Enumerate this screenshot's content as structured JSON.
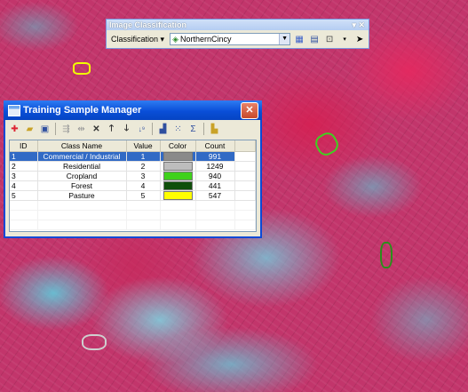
{
  "toolbar": {
    "title": "Image Classification",
    "menu_label": "Classification",
    "layer_value": "NorthernCincy"
  },
  "dialog": {
    "title": "Training Sample Manager",
    "columns": [
      "ID",
      "Class Name",
      "Value",
      "Color",
      "Count"
    ],
    "rows": [
      {
        "id": "1",
        "name": "Commercial / Industrial",
        "value": "1",
        "color": "#8a8a8a",
        "count": "991"
      },
      {
        "id": "2",
        "name": "Residential",
        "value": "2",
        "color": "#bdbdbd",
        "count": "1249"
      },
      {
        "id": "3",
        "name": "Cropland",
        "value": "3",
        "color": "#3fd11c",
        "count": "940"
      },
      {
        "id": "4",
        "name": "Forest",
        "value": "4",
        "color": "#0f4f0a",
        "count": "441"
      },
      {
        "id": "5",
        "name": "Pasture",
        "value": "5",
        "color": "#ffff00",
        "count": "547"
      }
    ],
    "selected_row": "1"
  },
  "colors": {
    "title_blue": "#0a4fd8",
    "selection_blue": "#316ac5",
    "imagery_red": "#c2356b",
    "imagery_cyan": "#6fd6e3"
  }
}
